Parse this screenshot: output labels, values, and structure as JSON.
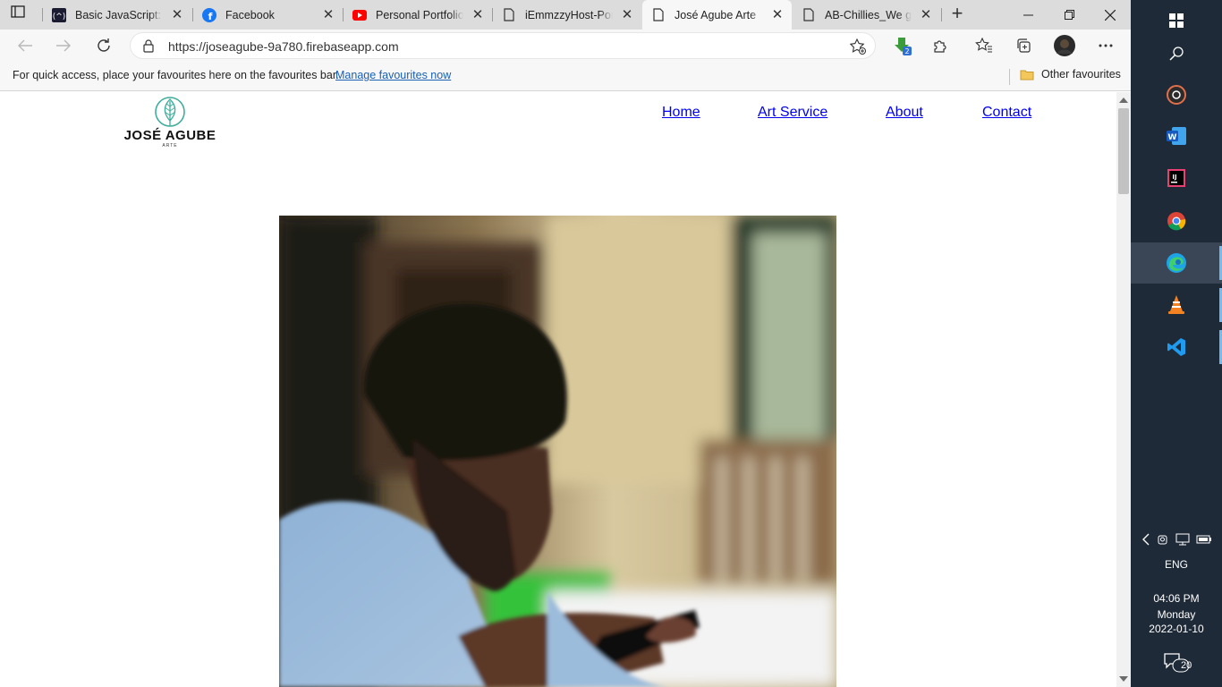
{
  "browser": {
    "tabs": [
      {
        "title": "Basic JavaScript: Ur",
        "icon": "fcc-icon",
        "active": false
      },
      {
        "title": "Facebook",
        "icon": "facebook-icon",
        "active": false
      },
      {
        "title": "Personal Portfolio W",
        "icon": "youtube-icon",
        "active": false
      },
      {
        "title": "iEmmzzyHost-Portf",
        "icon": "page-icon",
        "active": false
      },
      {
        "title": "José Agube Arte",
        "icon": "page-icon",
        "active": true
      },
      {
        "title": "AB-Chillies_We give",
        "icon": "page-icon",
        "active": false
      }
    ],
    "new_tab_label": "+",
    "address": {
      "url": "https://joseagube-9a780.firebaseapp.com"
    },
    "extension_badge": "2",
    "favourites_bar": {
      "message": "For quick access, place your favourites here on the favourites bar.",
      "link": "Manage favourites now",
      "other": "Other favourites"
    }
  },
  "site": {
    "logo": {
      "brand": "JOSÉ AGUBE",
      "sub": "ARTE"
    },
    "nav": [
      {
        "label": "Home"
      },
      {
        "label": "Art Service"
      },
      {
        "label": "About"
      },
      {
        "label": "Contact"
      }
    ],
    "hero_alt": "photo-of-man-using-phone"
  },
  "taskbar": {
    "apps": [
      "start-icon",
      "search-icon",
      "music-app-icon",
      "word-icon",
      "intellij-icon",
      "chrome-icon",
      "edge-icon",
      "vlc-icon",
      "vscode-icon"
    ],
    "language": "ENG",
    "time": "04:06 PM",
    "day": "Monday",
    "date": "2022-01-10",
    "notification_count": "20"
  },
  "colors": {
    "taskbar_bg": "#1f2a38",
    "link": "#1a5fb4",
    "logo_leaf": "#3fae9b"
  }
}
